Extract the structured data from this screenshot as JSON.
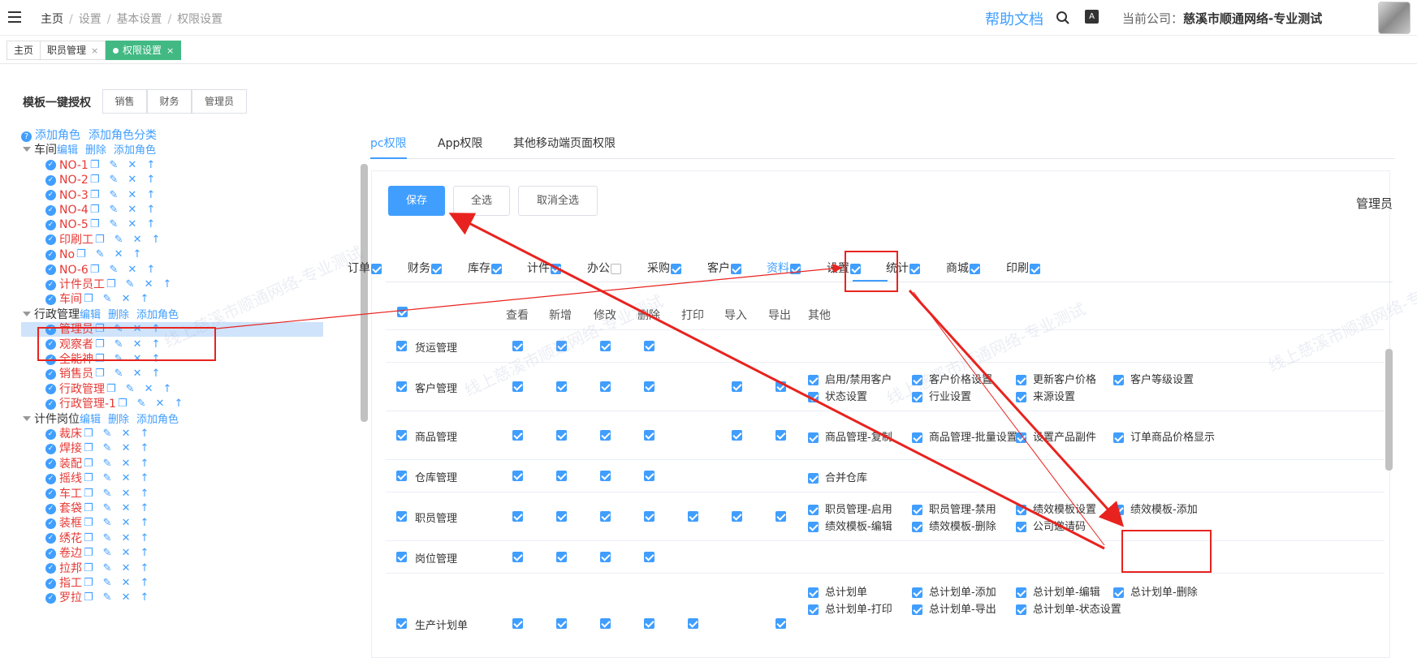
{
  "header": {
    "breadcrumb": [
      "主页",
      "设置",
      "基本设置",
      "权限设置"
    ],
    "help_link": "帮助文档",
    "font_badge": "A",
    "company_label": "当前公司：",
    "company_name": "慈溪市顺通网络-专业测试"
  },
  "page_tabs": [
    {
      "label": "主页",
      "closable": false,
      "active": false
    },
    {
      "label": "职员管理",
      "closable": true,
      "active": false
    },
    {
      "label": "权限设置",
      "closable": true,
      "active": true
    }
  ],
  "template": {
    "label": "模板一键授权",
    "buttons": [
      "销售",
      "财务",
      "管理员"
    ]
  },
  "tree": {
    "add_role": "添加角色",
    "add_category": "添加角色分类",
    "groups": [
      {
        "name": "车间",
        "actions": [
          "编辑",
          "删除",
          "添加角色"
        ],
        "roles": [
          "NO-1",
          "NO-2",
          "NO-3",
          "NO-4",
          "NO-5",
          "印刷工",
          "No",
          "NO-6",
          "计件员工",
          "车间"
        ]
      },
      {
        "name": "行政管理",
        "actions": [
          "编辑",
          "删除",
          "添加角色"
        ],
        "roles": [
          "管理员",
          "观察者",
          "全能神",
          "销售员",
          "行政管理",
          "行政管理-1"
        ]
      },
      {
        "name": "计件岗位",
        "actions": [
          "编辑",
          "删除",
          "添加角色"
        ],
        "roles": [
          "裁床",
          "焊接",
          "装配",
          "摇线",
          "车工",
          "套袋",
          "装框",
          "绣花",
          "卷边",
          "拉邦",
          "指工",
          "罗拉"
        ]
      }
    ],
    "selected_role": "管理员"
  },
  "perm_tabs": [
    "pc权限",
    "App权限",
    "其他移动端页面权限"
  ],
  "toolbar": {
    "save": "保存",
    "select_all": "全选",
    "deselect_all": "取消全选"
  },
  "current_role": "管理员",
  "categories": [
    {
      "label": "订单",
      "checked": true
    },
    {
      "label": "财务",
      "checked": true
    },
    {
      "label": "库存",
      "checked": true
    },
    {
      "label": "计件",
      "checked": true
    },
    {
      "label": "办公",
      "checked": false
    },
    {
      "label": "采购",
      "checked": true
    },
    {
      "label": "客户",
      "checked": true
    },
    {
      "label": "资料",
      "checked": true,
      "active": true
    },
    {
      "label": "设置",
      "checked": true
    },
    {
      "label": "统计",
      "checked": true
    },
    {
      "label": "商城",
      "checked": true
    },
    {
      "label": "印刷",
      "checked": true
    }
  ],
  "columns": [
    "查看",
    "新增",
    "修改",
    "删除",
    "打印",
    "导入",
    "导出",
    "其他"
  ],
  "rows": [
    {
      "name": "货运管理",
      "flags": [
        1,
        1,
        1,
        1,
        0,
        0,
        0
      ],
      "other": []
    },
    {
      "name": "客户管理",
      "flags": [
        1,
        1,
        1,
        1,
        0,
        1,
        1
      ],
      "other": [
        "启用/禁用客户",
        "客户价格设置",
        "更新客户价格",
        "客户等级设置",
        "状态设置",
        "行业设置",
        "来源设置"
      ]
    },
    {
      "name": "商品管理",
      "flags": [
        1,
        1,
        1,
        1,
        0,
        1,
        1
      ],
      "other": [
        "商品管理-复制",
        "商品管理-批量设置",
        "设置产品副件",
        "订单商品价格显示"
      ]
    },
    {
      "name": "仓库管理",
      "flags": [
        1,
        1,
        1,
        1,
        0,
        0,
        0
      ],
      "other": [
        "合并仓库"
      ]
    },
    {
      "name": "职员管理",
      "flags": [
        1,
        1,
        1,
        1,
        1,
        1,
        1
      ],
      "other": [
        "职员管理-启用",
        "职员管理-禁用",
        "绩效模板设置",
        "绩效模板-添加",
        "绩效模板-编辑",
        "绩效模板-删除",
        "公司邀请码"
      ]
    },
    {
      "name": "岗位管理",
      "flags": [
        1,
        1,
        1,
        1,
        0,
        0,
        0
      ],
      "other": []
    },
    {
      "name": "生产计划单",
      "flags": [
        1,
        1,
        1,
        1,
        1,
        0,
        1
      ],
      "other": [
        "总计划单",
        "总计划单-添加",
        "总计划单-编辑",
        "总计划单-删除",
        "总计划单-打印",
        "总计划单-导出",
        "总计划单-状态设置"
      ]
    }
  ],
  "watermark": "线上慈溪市顺通网络-专业测试",
  "colors": {
    "accent": "#409eff",
    "tab_active": "#42b983",
    "annotation": "#e8231f",
    "role_text": "#e53935"
  }
}
